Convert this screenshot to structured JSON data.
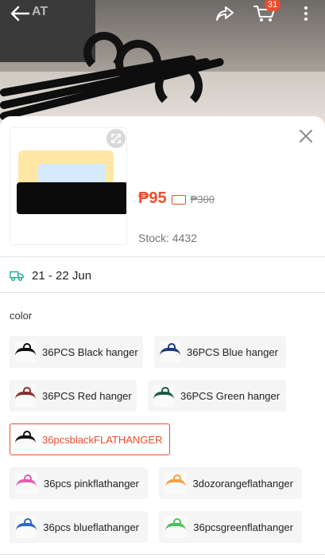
{
  "hero": {
    "logo_text": "AT",
    "cart_count": "31",
    "icons": [
      "back-arrow-icon",
      "share-icon",
      "cart-icon",
      "more-icon"
    ]
  },
  "sheet": {
    "price": "₱95",
    "old_price": "₱300",
    "stock_label": "Stock: 4432",
    "delivery": "21 - 22 Jun",
    "variation_label": "color",
    "options": [
      {
        "label": "36PCS Black hanger",
        "color": "#111111",
        "selected": false
      },
      {
        "label": "36PCS Blue hanger",
        "color": "#1f3b7a",
        "selected": false
      },
      {
        "label": "36PCS Red hanger",
        "color": "#8a2d2d",
        "selected": false
      },
      {
        "label": "36PCS Green hanger",
        "color": "#1d5b46",
        "selected": false
      },
      {
        "label": "36pcsblackFLATHANGER",
        "color": "#111111",
        "selected": true
      },
      {
        "label": "36pcs pinkflathanger",
        "color": "#e35ca8",
        "selected": false
      },
      {
        "label": "3dozorangeflathanger",
        "color": "#f0a146",
        "selected": false
      },
      {
        "label": "36pcs blueflathanger",
        "color": "#2f67c9",
        "selected": false
      },
      {
        "label": "36pcsgreenflathanger",
        "color": "#4bc05b",
        "selected": false
      }
    ]
  },
  "colors": {
    "accent": "#ee4d2d",
    "delivery_icon": "#26aa99"
  }
}
